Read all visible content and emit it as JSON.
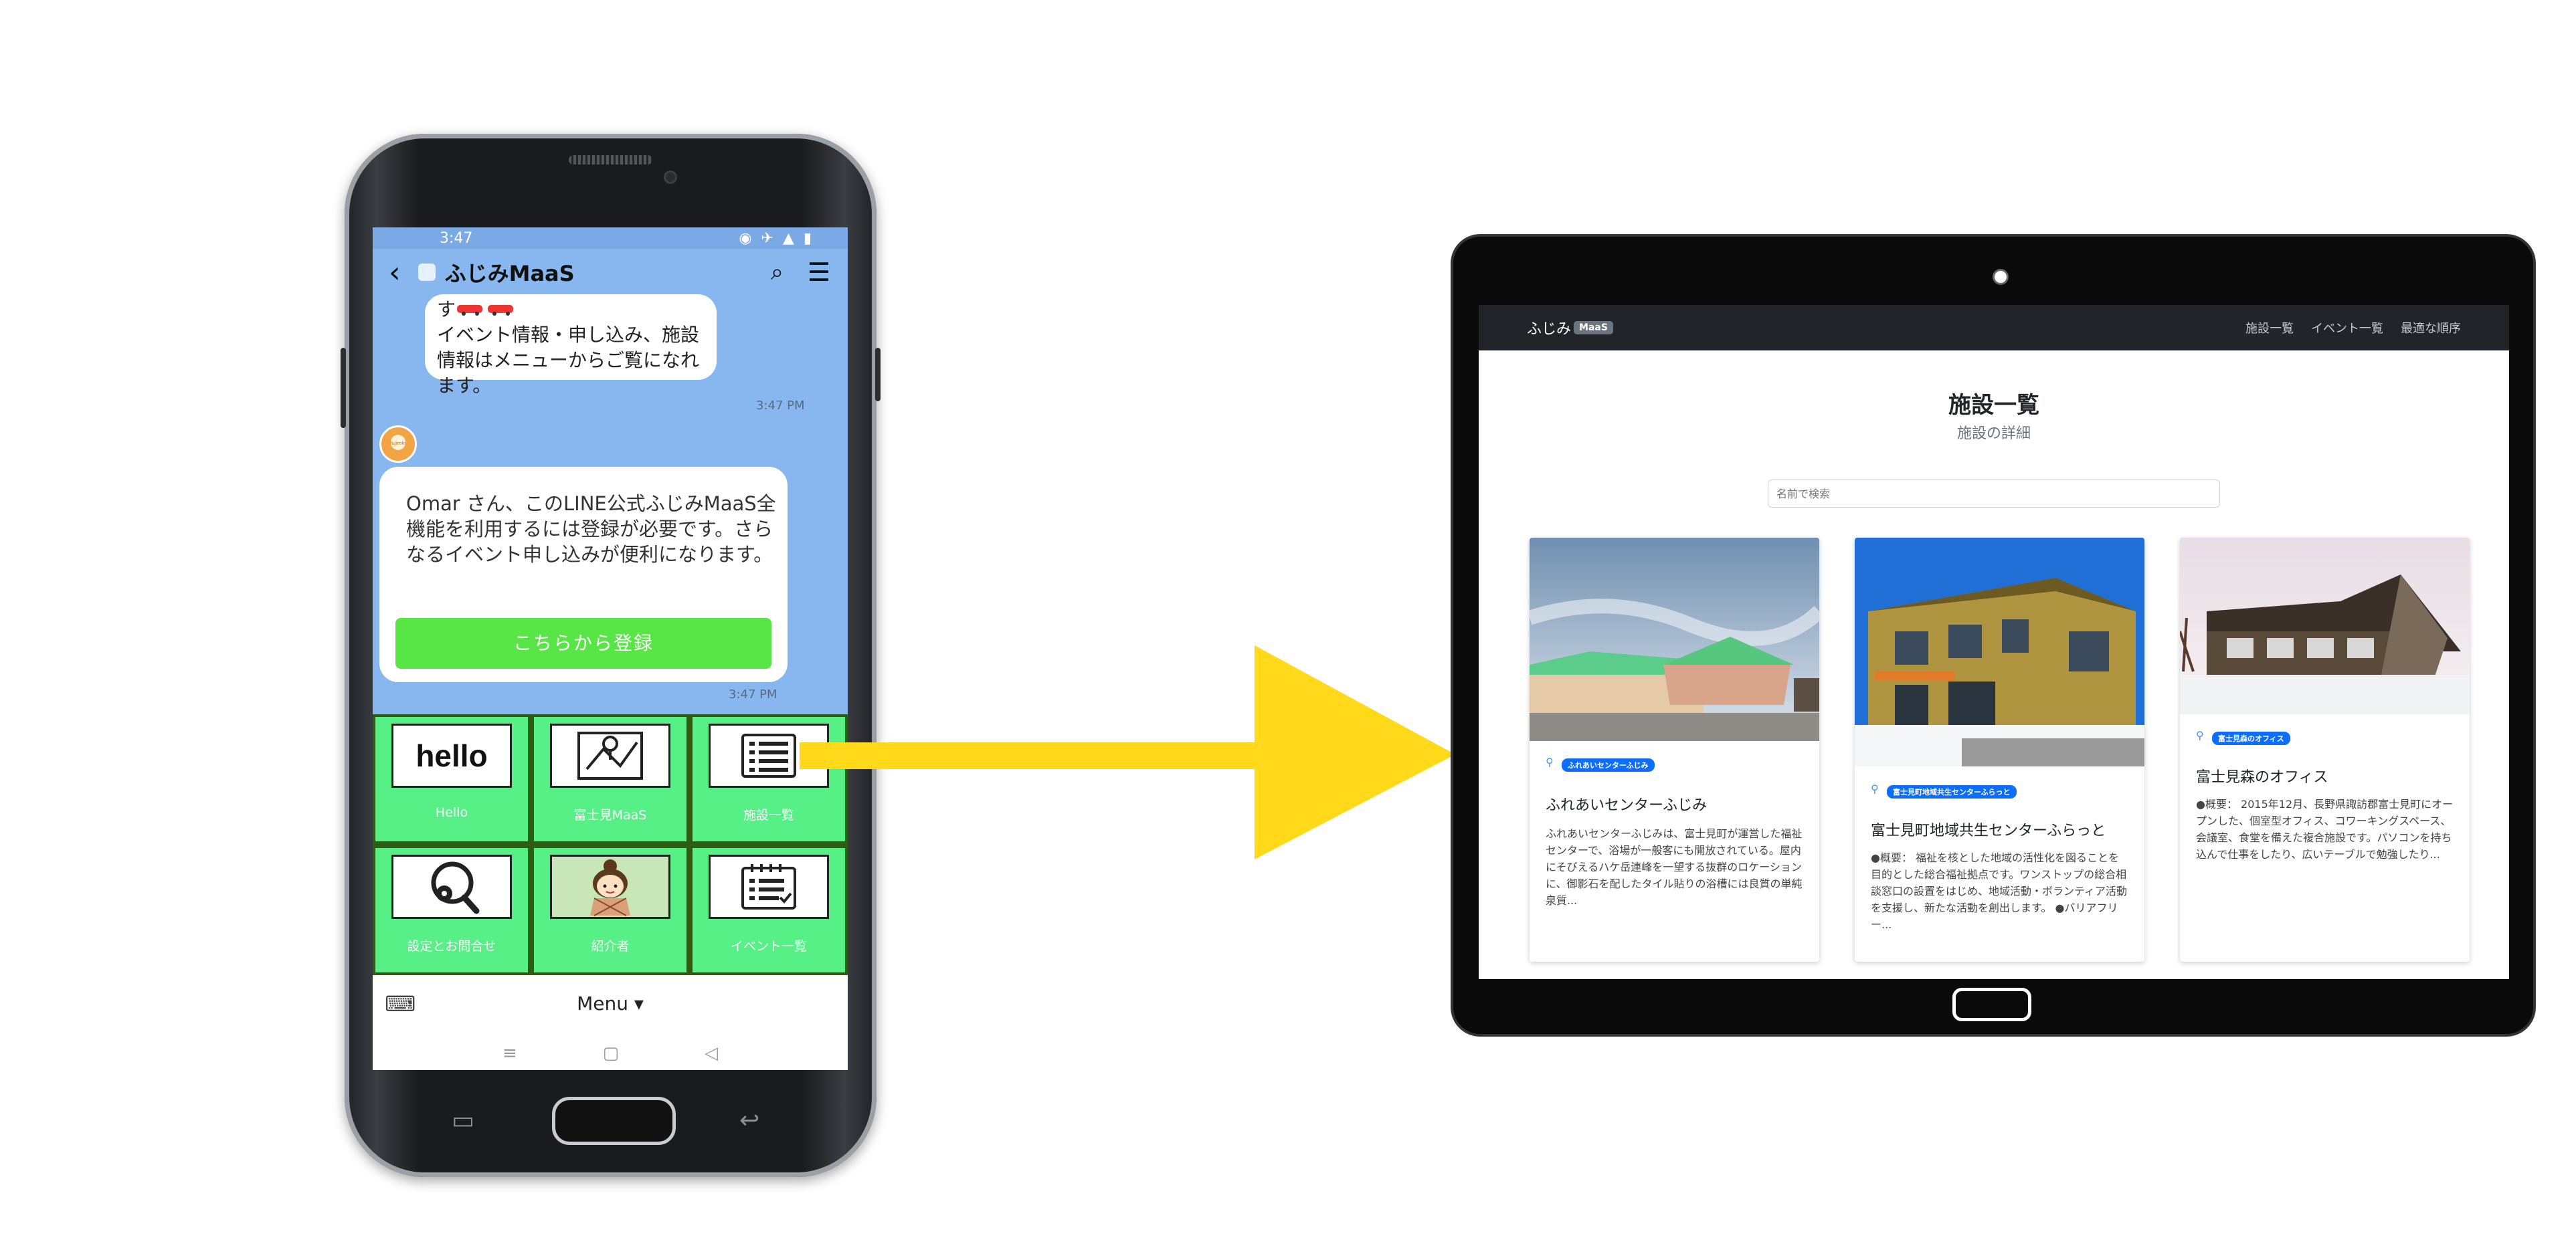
{
  "phone": {
    "status_time": "3:47",
    "header_title": "ふじみMaaS",
    "messages": {
      "bubble1_line1": "す",
      "bubble1_text": "イベント情報・申し込み、施設情報はメニューからご覧になれます。",
      "bubble1_time": "3:47 PM",
      "avatar_label": "fujimin",
      "bubble2_text": "Omar さん、このLINE公式ふじみMaaS全機能を利用するには登録が必要です。さらなるイベント申し込みが便利になります。",
      "register_button": "こちらから登録",
      "bubble2_time": "3:47 PM"
    },
    "rich_menu": [
      {
        "label": "Hello",
        "icon": "hello-logo"
      },
      {
        "label": "富士見MaaS",
        "icon": "map-pin-icon"
      },
      {
        "label": "施設一覧",
        "icon": "list-icon"
      },
      {
        "label": "設定とお問合せ",
        "icon": "gear-search-icon"
      },
      {
        "label": "紹介者",
        "icon": "mascot-image"
      },
      {
        "label": "イベント一覧",
        "icon": "calendar-list-icon"
      }
    ],
    "hello_word": "hello",
    "bottom_menu_label": "Menu ▾",
    "colors": {
      "chat_bg": "#87b7ee",
      "rich_menu_cell": "#57f087",
      "register_btn": "#57e646"
    }
  },
  "arrow": {
    "color": "#ffd91a"
  },
  "tablet": {
    "brand_text": "ふじみ",
    "brand_badge": "MaaS",
    "nav_links": [
      "施設一覧",
      "イベント一覧",
      "最適な順序"
    ],
    "page_title": "施設一覧",
    "page_subtitle": "施設の詳細",
    "search_placeholder": "名前で検索",
    "cards": [
      {
        "tag": "ふれあいセンターふじみ",
        "name": "ふれあいセンターふじみ",
        "description": "ふれあいセンターふじみは、富士見町が運営した福祉センターで、浴場が一般客にも開放されている。屋内にそびえるハケ岳連峰を一望する抜群のロケーションに、御影石を配したタイル貼りの浴槽には良質の単純泉質...",
        "image": "photo-building-green-roof"
      },
      {
        "tag": "富士見町地域共生センターふらっと",
        "name": "富士見町地域共生センターふらっと",
        "description": "●概要： 福祉を核とした地域の活性化を図ることを目的とした総合福祉拠点です。ワンストップの総合相談窓口の設置をはじめ、地域活動・ボランティア活動を支援し、新たな活動を創出します。 ●バリアフリー...",
        "image": "photo-yellow-building"
      },
      {
        "tag": "富士見森のオフィス",
        "name": "富士見森のオフィス",
        "description": "●概要： 2015年12月、長野県諏訪郡富士見町にオープンした、個室型オフィス、コワーキングスペース、会議室、食堂を備えた複合施設です。パソコンを持ち込んで仕事をしたり、広いテーブルで勉強したり...",
        "image": "photo-wooden-office"
      }
    ]
  }
}
